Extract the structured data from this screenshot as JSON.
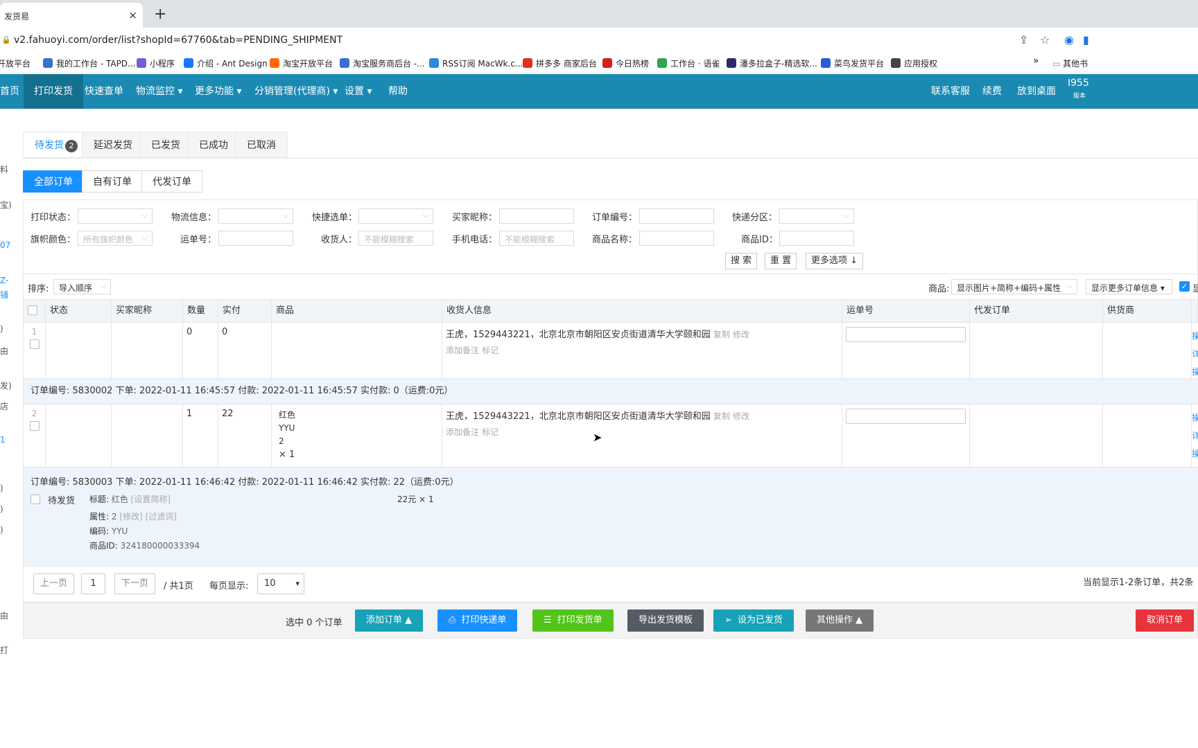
{
  "browser": {
    "tab_title": "发货易",
    "close": "×",
    "new_tab": "+",
    "url": "v2.fahuoyi.com/order/list?shopId=67760&tab=PENDING_SHIPMENT",
    "bookmarks": [
      {
        "label": "开放平台",
        "color": "#e65b2b"
      },
      {
        "label": "我的工作台 - TAPD...",
        "color": "#3a6fd0"
      },
      {
        "label": "小程序",
        "color": "#7a5ad6"
      },
      {
        "label": "介绍 - Ant Design",
        "color": "#1677ff"
      },
      {
        "label": "淘宝开放平台",
        "color": "#ff6a00"
      },
      {
        "label": "淘宝服务商后台 -...",
        "color": "#3a6fd0"
      },
      {
        "label": "RSS订阅 MacWk.c...",
        "color": "#2c8ad8"
      },
      {
        "label": "拼多多 商家后台",
        "color": "#e02e24"
      },
      {
        "label": "今日热榜",
        "color": "#d62020"
      },
      {
        "label": "工作台 · 语雀",
        "color": "#31a353"
      },
      {
        "label": "潘多拉盒子-精选软...",
        "color": "#2b2b6b"
      },
      {
        "label": "菜鸟发货平台",
        "color": "#2a5bd7"
      },
      {
        "label": "应用授权",
        "color": "#444444"
      }
    ],
    "more_bookmarks": "»",
    "other_bookmarks": "其他书"
  },
  "nav": {
    "items": [
      "首页",
      "打印发货",
      "快速查单",
      "物流监控 ▾",
      "更多功能 ▾",
      "分销管理(代理商) ▾",
      "设置 ▾",
      "帮助"
    ],
    "right": [
      "联系客服",
      "续费",
      "放到桌面",
      "I955"
    ],
    "version": "版本"
  },
  "left_strip": [
    "料",
    "宝)",
    "07",
    "Z-",
    "铺",
    ")",
    "由",
    "发)",
    "店",
    "1",
    ")",
    ")",
    ")",
    "由",
    "打"
  ],
  "tabs": {
    "pending": "待发货",
    "pending_count": "2",
    "delayed": "延迟发货",
    "shipped": "已发货",
    "success": "已成功",
    "cancelled": "已取消"
  },
  "subtabs": {
    "all": "全部订单",
    "own": "自有订单",
    "proxy": "代发订单"
  },
  "filters": {
    "print_status": "打印状态：",
    "logistics": "物流信息：",
    "express_form": "快捷选单：",
    "buyer_nick": "买家昵称：",
    "order_no": "订单编号：",
    "express_zone": "快递分区：",
    "flag_color": "旗帜颜色：",
    "flag_placeholder": "所有旗帜颜色",
    "waybill": "运单号：",
    "receiver": "收货人：",
    "receiver_placeholder": "不能模糊搜索",
    "phone": "手机电话：",
    "phone_placeholder": "不能模糊搜索",
    "goods_name": "商品名称：",
    "goods_id": "商品ID：",
    "search": "搜 索",
    "reset": "重 置",
    "more": "更多选项 ↓"
  },
  "sort": {
    "label": "排序:",
    "value": "导入顺序",
    "goods_label": "商品:",
    "goods_value": "显示图片+简称+编码+属性",
    "more_info": "显示更多订单信息 ▾",
    "check_label": "显"
  },
  "table": {
    "headers": [
      "状态",
      "买家昵称",
      "数量",
      "实付",
      "商品",
      "收货人信息",
      "运单号",
      "代发订单",
      "供货商"
    ],
    "rows": [
      {
        "index": "1",
        "qty": "0",
        "paid": "0",
        "goods": [],
        "receiver": "王虎，1529443221，北京北京市朝阳区安贞街道清华大学颐和园",
        "copy": "复制",
        "edit": "修改",
        "note": "添加备注",
        "mark": "标记",
        "info": "订单编号: 5830002   下单: 2022-01-11 16:45:57   付款: 2022-01-11 16:45:57   实付款: 0（运费:0元）"
      },
      {
        "index": "2",
        "qty": "1",
        "paid": "22",
        "goods": [
          "红色",
          "YYU",
          "2",
          "× 1"
        ],
        "receiver": "王虎，1529443221，北京北京市朝阳区安贞街道清华大学颐和园",
        "copy": "复制",
        "edit": "修改",
        "note": "添加备注",
        "mark": "标记",
        "info": "订单编号: 5830003   下单: 2022-01-11 16:46:42   付款: 2022-01-11 16:46:42   实付款: 22（运费:0元）"
      }
    ],
    "row_side_chars": [
      "操",
      "详",
      "操"
    ]
  },
  "detail": {
    "status": "待发货",
    "title_label": "标题:",
    "title_value": "红色",
    "set_short": "[设置简称]",
    "attr_label": "属性:",
    "attr_value": "2",
    "attr_edit": "[修改]",
    "attr_filter": "[过滤词]",
    "code_label": "编码:",
    "code_value": "YYU",
    "gid_label": "商品ID:",
    "gid_value": "324180000033394",
    "price": "22元 × 1"
  },
  "pager": {
    "prev": "上一页",
    "page": "1",
    "next": "下一页",
    "total": "/ 共1页",
    "per_page_label": "每页显示:",
    "per_page": "10",
    "summary": "当前显示1-2条订单，共2条"
  },
  "actions": {
    "selected": "选中 0 个订单",
    "add_order": "添加订单",
    "print_express": "打印快递单",
    "print_ship": "打印发货单",
    "export": "导出发货模板",
    "set_shipped": "设为已发货",
    "other": "其他操作",
    "cancel": "取消订单"
  },
  "colors": {
    "nav": "#1b8ab2",
    "primary": "#1890ff",
    "teal": "#17a2b8",
    "green": "#52c41a",
    "grey": "#666666",
    "danger": "#e8333a"
  }
}
